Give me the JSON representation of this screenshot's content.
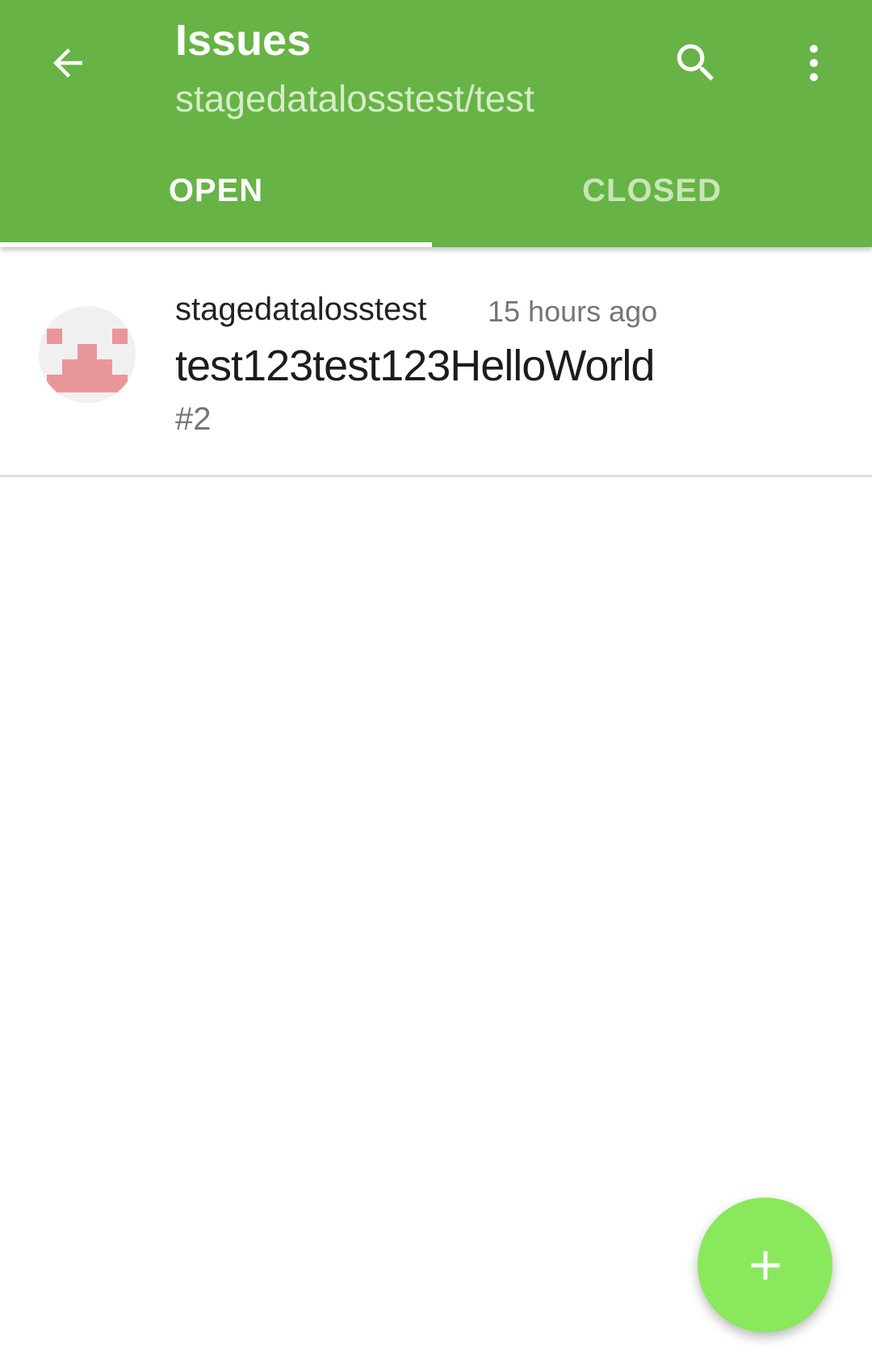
{
  "colors": {
    "appbar": "#67b346",
    "fab": "#8ae85c",
    "tab_active": "#ffffff",
    "tab_inactive": "#c7e6b6",
    "avatar_pixels": "#e9969b"
  },
  "appbar": {
    "title": "Issues",
    "subtitle": "stagedatalosstest/test",
    "icons": {
      "back": "arrow-back-icon",
      "search": "search-icon",
      "more": "more-vert-icon"
    }
  },
  "tabs": [
    {
      "label": "OPEN",
      "active": true
    },
    {
      "label": "CLOSED",
      "active": false
    }
  ],
  "issues": [
    {
      "author": "stagedatalosstest",
      "time": "15 hours ago",
      "title": "test123test123HelloWorld",
      "number": "#2",
      "avatar_icon": "identicon-avatar"
    }
  ],
  "fab": {
    "icon": "plus-icon"
  }
}
